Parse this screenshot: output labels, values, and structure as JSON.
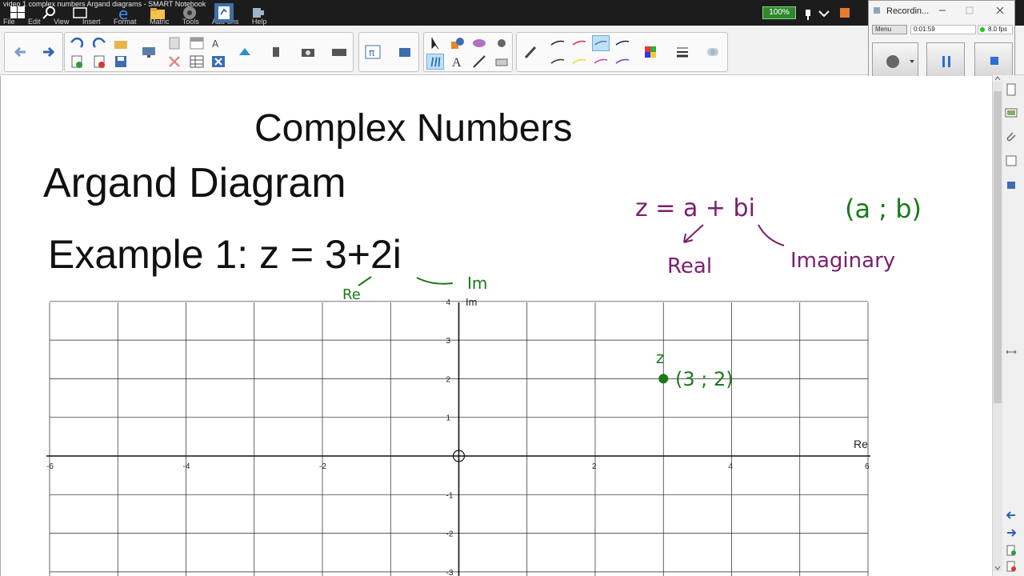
{
  "taskbar": {
    "window_title": "video 1 complex numbers Argand diagrams - SMART Notebook",
    "menu": [
      "File",
      "Edit",
      "View",
      "Insert",
      "Format",
      "Matric",
      "Tools",
      "Add-ons",
      "Help"
    ],
    "battery_zoom": "100%"
  },
  "recorder": {
    "title": "Recordin...",
    "menu_label": "Menu",
    "elapsed": "0:01:59",
    "fps": "8.0 fps"
  },
  "page": {
    "title": "Complex Numbers",
    "subtitle": "Argand Diagram",
    "example": "Example 1: z = 3+2i"
  },
  "annotations": {
    "re_label": "Re",
    "im_label": "Im",
    "formula": "z = a + bi",
    "pair": "(a ; b)",
    "real_word": "Real",
    "imaginary_word": "Imaginary",
    "point_name": "z",
    "point_coords": "(3 ; 2)"
  },
  "chart_data": {
    "type": "scatter",
    "xlabel": "Re",
    "ylabel": "Im",
    "xlim": [
      -6,
      6
    ],
    "ylim": [
      -3,
      4
    ],
    "x_ticks": [
      "-6",
      "-4",
      "-2",
      "2",
      "4",
      "6"
    ],
    "y_ticks": [
      "4",
      "3",
      "2",
      "1",
      "-1",
      "-2",
      "-3"
    ],
    "grid": true,
    "points": [
      {
        "x": 3,
        "y": 2,
        "label": "z"
      }
    ],
    "colors": {
      "ink_green": "#1a7a1a",
      "ink_purple": "#7a1f6e"
    }
  }
}
